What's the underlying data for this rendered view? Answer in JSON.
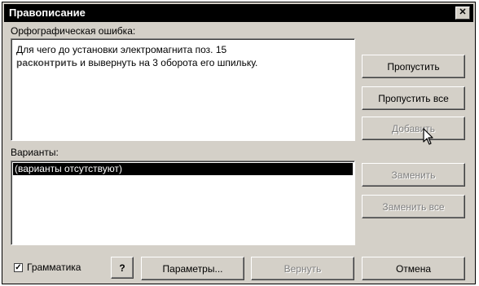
{
  "window": {
    "title": "Правописание",
    "close_glyph": "✕"
  },
  "spelling_error": {
    "label": "Орфографическая ошибка:",
    "text_line1": "Для чего до установки электромагнита поз. 15",
    "highlighted_word": "расконтрить",
    "text_line2_rest": " и вывернуть на 3 оборота его шпильку."
  },
  "suggestions": {
    "label": "Варианты:",
    "items": [
      "(варианты отсутствуют)"
    ]
  },
  "buttons": {
    "skip": "Пропустить",
    "skip_all": "Пропустить все",
    "add": "Добавить",
    "replace": "Заменить",
    "replace_all": "Заменить все",
    "params": "Параметры...",
    "undo": "Вернуть",
    "cancel": "Отмена"
  },
  "grammar": {
    "label": "Грамматика",
    "checked": true,
    "check_glyph": "✓"
  },
  "help_glyph": "?"
}
